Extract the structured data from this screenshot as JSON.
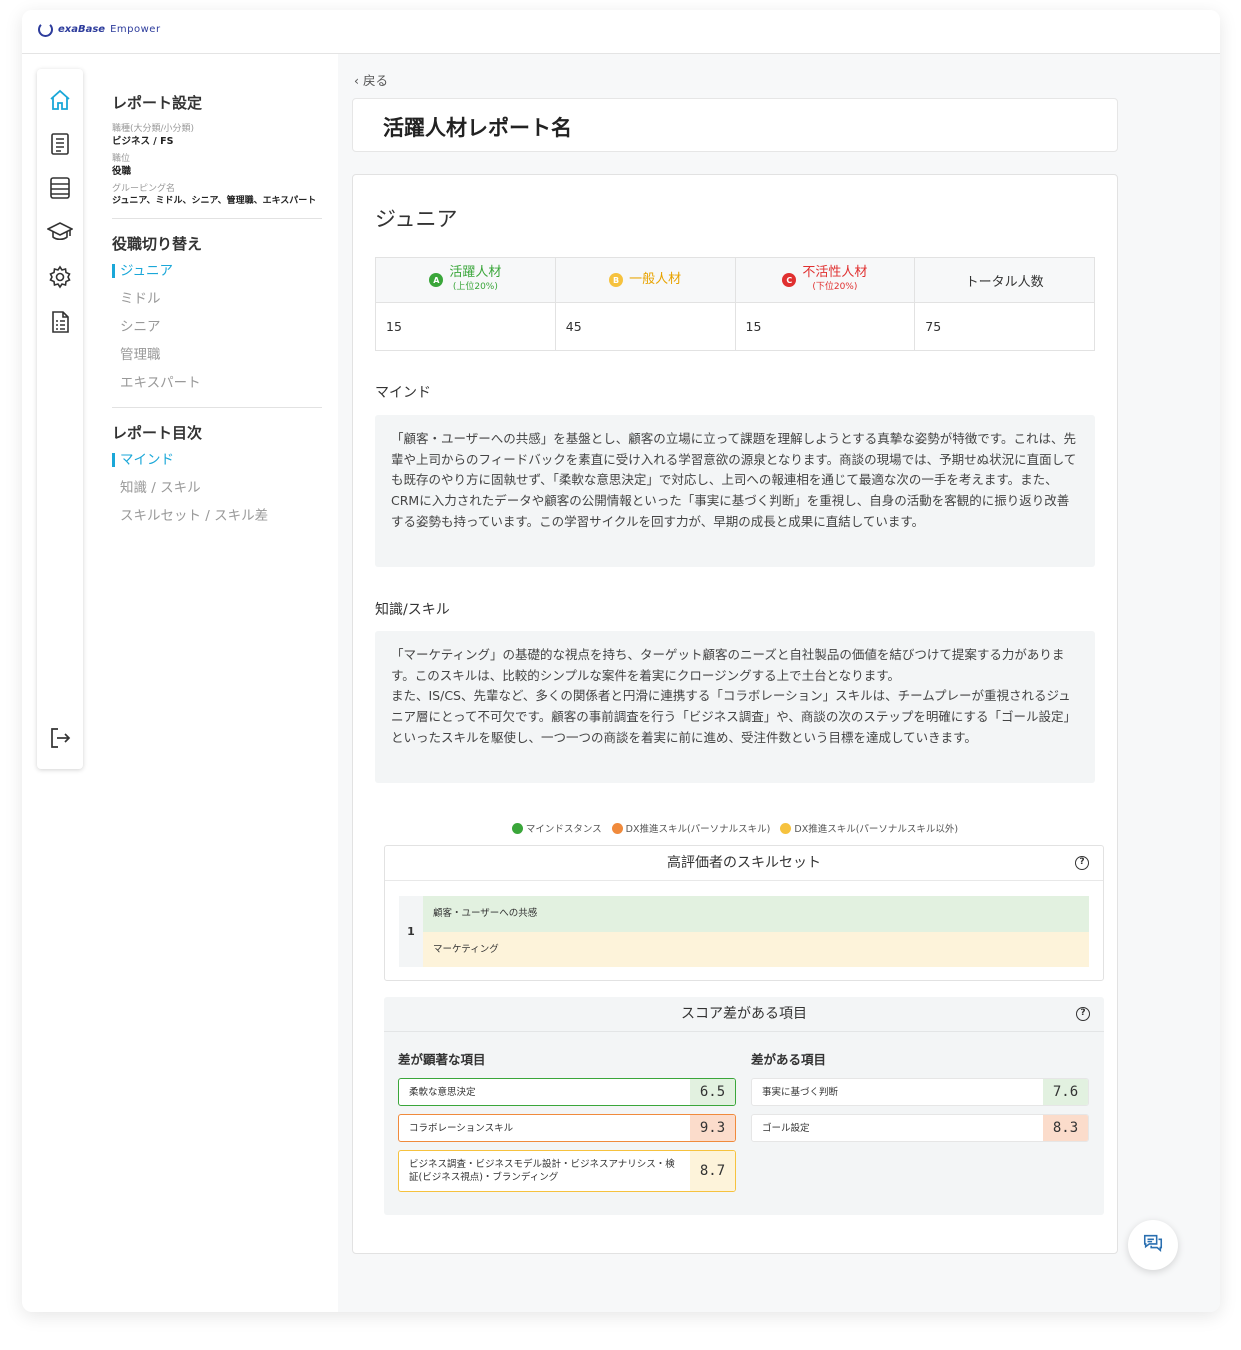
{
  "app": {
    "brand_main": "exaBase",
    "brand_sub": "Empower"
  },
  "rail": {
    "icons": [
      "home-icon",
      "document-icon",
      "table-icon",
      "graduation-cap-icon",
      "gear-icon",
      "report-icon",
      "logout-icon"
    ]
  },
  "sidebar": {
    "report_settings_title": "レポート設定",
    "job_type_label": "職種(大分類/小分類)",
    "job_type_value": "ビジネス / FS",
    "position_label": "職位",
    "position_value": "役職",
    "grouping_label": "グルーピング名",
    "grouping_value": "ジュニア、ミドル、シニア、管理職、エキスパート",
    "role_switch_title": "役職切り替え",
    "roles": [
      "ジュニア",
      "ミドル",
      "シニア",
      "管理職",
      "エキスパート"
    ],
    "toc_title": "レポート目次",
    "toc": [
      "マインド",
      "知識 / スキル",
      "スキルセット / スキル差"
    ]
  },
  "main": {
    "back_label": "戻る",
    "report_title": "活躍人材レポート名",
    "level_title": "ジュニア",
    "summary": {
      "headers": [
        {
          "badge": "A",
          "label": "活躍人材",
          "sub": "(上位20%)",
          "color": "#3aa63a"
        },
        {
          "badge": "B",
          "label": "一般人材",
          "sub": "",
          "color": "#e8b000"
        },
        {
          "badge": "C",
          "label": "不活性人材",
          "sub": "(下位20%)",
          "color": "#e03030"
        },
        {
          "badge": "",
          "label": "トータル人数",
          "sub": "",
          "color": "#333333"
        }
      ],
      "values": [
        "15",
        "45",
        "15",
        "75"
      ]
    },
    "mind": {
      "title": "マインド",
      "text": "「顧客・ユーザーへの共感」を基盤とし、顧客の立場に立って課題を理解しようとする真摯な姿勢が特徴です。これは、先輩や上司からのフィードバックを素直に受け入れる学習意欲の源泉となります。商談の現場では、予期せぬ状況に直面しても既存のやり方に固執せず、「柔軟な意思決定」で対応し、上司への報連相を通じて最適な次の一手を考えます。また、CRMに入力されたデータや顧客の公開情報といった「事実に基づく判断」を重視し、自身の活動を客観的に振り返り改善する姿勢も持っています。この学習サイクルを回す力が、早期の成長と成果に直結しています。"
    },
    "knowledge": {
      "title": "知識/スキル",
      "text1": "「マーケティング」の基礎的な視点を持ち、ターゲット顧客のニーズと自社製品の価値を結びつけて提案する力があります。このスキルは、比較的シンプルな案件を着実にクロージングする上で土台となります。",
      "text2": "また、IS/CS、先輩など、多くの関係者と円滑に連携する「コラボレーション」スキルは、チームプレーが重視されるジュニア層にとって不可欠です。顧客の事前調査を行う「ビジネス調査」や、商談の次のステップを明確にする「ゴール設定」といったスキルを駆使し、一つ一つの商談を着実に前に進め、受注件数という目標を達成していきます。"
    },
    "legend": [
      {
        "label": "マインドスタンス",
        "color": "#3aa63a"
      },
      {
        "label": "DX推進スキル(パーソナルスキル)",
        "color": "#f08a3c"
      },
      {
        "label": "DX推進スキル(パーソナルスキル以外)",
        "color": "#f6c23e"
      }
    ],
    "skillset": {
      "title": "高評価者のスキルセット",
      "rank": "1",
      "items": [
        {
          "label": "顧客・ユーザーへの共感",
          "bg": "#e2f1e0"
        },
        {
          "label": "マーケティング",
          "bg": "#fdf3da"
        }
      ]
    },
    "score_diff": {
      "title": "スコア差がある項目",
      "left_title": "差が顕著な項目",
      "left": [
        {
          "label": "柔軟な意思決定",
          "value": "6.5",
          "border": "#3aa63a",
          "valbg": "#e2f1e0"
        },
        {
          "label": "コラボレーションスキル",
          "value": "9.3",
          "border": "#f08a3c",
          "valbg": "#fbdccb"
        },
        {
          "label": "ビジネス調査・ビジネスモデル設計・ビジネスアナリシス・検証(ビジネス視点)・ブランディング",
          "value": "8.7",
          "border": "#f6c23e",
          "valbg": "#fdf3da"
        }
      ],
      "right_title": "差がある項目",
      "right": [
        {
          "label": "事実に基づく判断",
          "value": "7.6",
          "border": "#e6e6e6",
          "valbg": "#e2f1e0"
        },
        {
          "label": "ゴール設定",
          "value": "8.3",
          "border": "#e6e6e6",
          "valbg": "#fbdccb"
        }
      ]
    }
  }
}
